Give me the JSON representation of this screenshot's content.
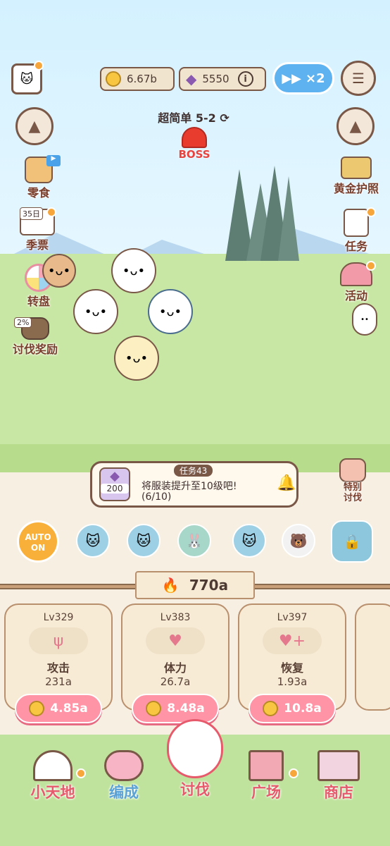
{
  "top": {
    "coins": "6.67b",
    "gems": "5550",
    "info_icon": "i",
    "speed": "×2"
  },
  "stage": {
    "name": "超简单 5-2",
    "boss": "BOSS"
  },
  "left_menu": [
    {
      "label": "零食"
    },
    {
      "label": "季票",
      "badge": "35日"
    },
    {
      "label": "转盘"
    },
    {
      "label": "讨伐奖励",
      "badge": "2%"
    }
  ],
  "right_menu": [
    {
      "label": "黄金护照"
    },
    {
      "label": "任务"
    },
    {
      "label": "活动"
    }
  ],
  "mission": {
    "title": "任务43",
    "text": "将服装提升至10级吧!",
    "progress": "(6/10)",
    "reward": "200"
  },
  "special": {
    "label": "特别\n讨伐",
    "line1": "特别",
    "line2": "讨伐"
  },
  "auto": {
    "line1": "AUTO",
    "line2": "ON"
  },
  "power": "770a",
  "cards": [
    {
      "level": "Lv329",
      "name": "攻击",
      "value": "231a",
      "cost": "4.85a"
    },
    {
      "level": "Lv383",
      "name": "体力",
      "value": "26.7a",
      "cost": "8.48a"
    },
    {
      "level": "Lv397",
      "name": "恢复",
      "value": "1.93a",
      "cost": "10.8a"
    }
  ],
  "nav": [
    {
      "label": "小天地"
    },
    {
      "label": "编成"
    },
    {
      "label": "讨伐"
    },
    {
      "label": "广场"
    },
    {
      "label": "商店"
    }
  ],
  "colors": {
    "accent": "#f59a2e",
    "nav_label": "#e65a6c",
    "cost_button": "#ff94a6"
  }
}
